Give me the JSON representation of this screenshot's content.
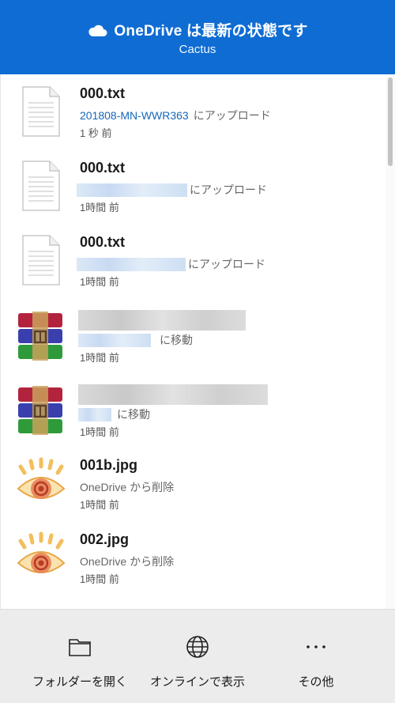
{
  "header": {
    "title": "OneDrive は最新の状態です",
    "subtitle": "Cactus"
  },
  "items": [
    {
      "name": "000.txt",
      "location": "201808-MN-WWR363",
      "action": "にアップロード",
      "time": "1 秒 前",
      "icon": "text-file-icon"
    },
    {
      "name": "000.txt",
      "location": "",
      "action": "にアップロード",
      "time": "1時間 前",
      "icon": "text-file-icon"
    },
    {
      "name": "000.txt",
      "location": "",
      "action": "にアップロード",
      "time": "1時間 前",
      "icon": "text-file-icon"
    },
    {
      "name": "",
      "location": "",
      "action": "に移動",
      "time": "1時間 前",
      "icon": "archive-icon"
    },
    {
      "name": "",
      "location": "",
      "action": "に移動",
      "time": "1時間 前",
      "icon": "archive-icon"
    },
    {
      "name": "001b.jpg",
      "location": "OneDrive",
      "action": "から削除",
      "time": "1時間 前",
      "icon": "image-viewer-icon"
    },
    {
      "name": "002.jpg",
      "location": "OneDrive",
      "action": "から削除",
      "time": "1時間 前",
      "icon": "image-viewer-icon"
    }
  ],
  "footer": {
    "open_folder": "フォルダーを開く",
    "view_online": "オンラインで表示",
    "more": "その他"
  },
  "colors": {
    "header_bg": "#0f6cd3",
    "link": "#1667b7",
    "footer_bg": "#ececec"
  }
}
